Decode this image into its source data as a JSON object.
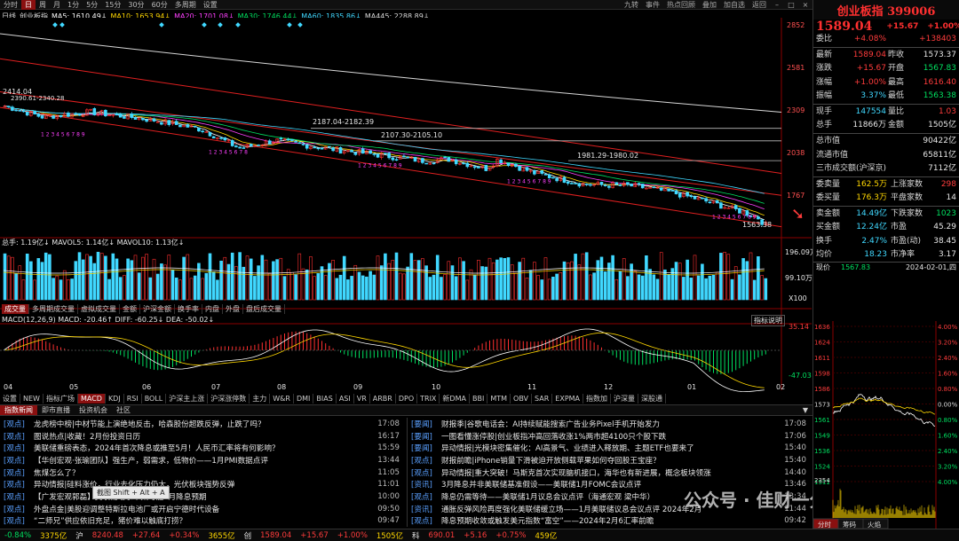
{
  "toolbar": {
    "periods": [
      "分时",
      "日",
      "周",
      "月",
      "1分",
      "5分",
      "15分",
      "30分",
      "60分",
      "多周期",
      "设置"
    ],
    "active": "日",
    "right": [
      "九转",
      "事件",
      "热点回顾",
      "叠加",
      "加自选",
      "返回"
    ]
  },
  "ma": {
    "label": "日线",
    "name": "创业板指",
    "items": [
      {
        "t": "MA5: 1610.49↓",
        "c": "#ffffff"
      },
      {
        "t": "MA10: 1653.94↓",
        "c": "#ffd700"
      },
      {
        "t": "MA20: 1701.08↓",
        "c": "#ff40ff"
      },
      {
        "t": "MA30: 1746.44↓",
        "c": "#00e060"
      },
      {
        "t": "MA60: 1835.86↓",
        "c": "#40d8ff"
      },
      {
        "t": "MA445: 2288.89↓",
        "c": "#d8d8d8"
      }
    ]
  },
  "price_axis": [
    "2852",
    "2581",
    "2309",
    "2038",
    "1767"
  ],
  "annotations": {
    "a1": "2414.04",
    "a2": "2390.61-2340.28",
    "a3": "2187.04-2182.39",
    "a4": "2107.30-2105.10",
    "a5": "1981.29-1980.02",
    "low": "1563.38"
  },
  "vol": {
    "head": "总手: 1.19亿↓  MAVOL5: 1.14亿↓  MAVOL10: 1.13亿↓",
    "axis": [
      "196.09万",
      "99.10万",
      "X100"
    ],
    "tabs": [
      "成交量",
      "多周期成交量",
      "虚拟成交量",
      "金额",
      "沪深金额",
      "换手率",
      "内盘",
      "外盘",
      "盘后成交量"
    ]
  },
  "macd": {
    "head": "MACD(12,26,9)  MACD: -20.46↑  DIFF: -60.25↓  DEA: -50.02↓",
    "btn": "指标说明",
    "axis": [
      "35.14",
      "-47.03"
    ],
    "months": [
      "04",
      "05",
      "06",
      "07",
      "08",
      "09",
      "10",
      "11",
      "12",
      "01",
      "02"
    ]
  },
  "ind_tabs": [
    "设置",
    "NEW",
    "指标广场",
    "MACD",
    "KDJ",
    "RSI",
    "BOLL",
    "沪深主上涨",
    "沪深涨停数",
    "主力",
    "W&R",
    "DMI",
    "BIAS",
    "ASI",
    "VR",
    "ARBR",
    "DPO",
    "TRIX",
    "新DMA",
    "BBI",
    "MTM",
    "OBV",
    "SAR",
    "EXPMA",
    "指数加",
    "沪深量",
    "深股通"
  ],
  "quote": {
    "title": "创业板指 399006",
    "price": "1589.04",
    "chg": "+15.67",
    "pct": "+1.00%",
    "rows": [
      [
        "委比",
        "+4.08%",
        "",
        "+138403"
      ],
      [
        "最新",
        "1589.04",
        "昨收",
        "1573.37"
      ],
      [
        "涨跌",
        "+15.67",
        "开盘",
        "1567.83"
      ],
      [
        "涨幅",
        "+1.00%",
        "最高",
        "1616.40"
      ],
      [
        "振幅",
        "3.37%",
        "最低",
        "1563.38"
      ],
      [
        "现手",
        "147554",
        "量比",
        "1.03"
      ],
      [
        "总手",
        "11866万",
        "金额",
        "1505亿"
      ]
    ],
    "rows2": [
      [
        "总市值",
        "",
        "90422亿"
      ],
      [
        "流通市值",
        "",
        "65811亿"
      ],
      [
        "三市成交额(沪深京)",
        "",
        "7112亿"
      ]
    ],
    "rows3": [
      [
        "委卖量",
        "162.5万",
        "上涨家数",
        "298"
      ],
      [
        "委买量",
        "176.3万",
        "平盘家数",
        "14"
      ],
      [
        "卖金额",
        "14.49亿",
        "下跌家数",
        "1023"
      ],
      [
        "买金额",
        "12.24亿",
        "市盈",
        "45.29"
      ],
      [
        "换手",
        "2.47%",
        "市盈(动)",
        "38.45"
      ],
      [
        "均价",
        "18.23",
        "市净率",
        "3.17"
      ]
    ],
    "mini_head": [
      "现价",
      "1567.83",
      "2024-02-01,四"
    ],
    "mini_left": [
      "1636",
      "1624",
      "1611",
      "1598",
      "1586",
      "1573",
      "1561",
      "1549",
      "1536",
      "1524",
      "1511"
    ],
    "mini_right": [
      "4.00%",
      "3.20%",
      "2.40%",
      "1.60%",
      "0.80%",
      "0.00%",
      "0.80%",
      "1.60%",
      "2.40%",
      "3.20%",
      "4.00%"
    ],
    "mini_vol": "2354",
    "mini_tabs": [
      "分时",
      "筹码",
      "火焰"
    ]
  },
  "news": {
    "tabs": [
      "指数新闻",
      "即市直播",
      "投资机会",
      "社区"
    ],
    "left": [
      [
        "观点",
        "龙虎榜中榜|中材节能上演绝地反击，哈森股份超跌反弹，止跌了吗？",
        "17:08"
      ],
      [
        "观点",
        "图说热点|收藏！2月份投资日历",
        "16:17"
      ],
      [
        "观点",
        "美联储重磅表态，2024年首次降息或推至5月！人民币汇率将有何影响？",
        "15:59"
      ],
      [
        "观点",
        "【华创宏观·张瑜团队】强生产，弱需求，低物价——1月PMI数据点评",
        "13:44"
      ],
      [
        "观点",
        "焦煤怎么了？",
        "11:05"
      ],
      [
        "观点",
        "异动情报|硅料涨价，行业去化压力仍大，光伏板块强势反弹",
        "11:01"
      ],
      [
        "观点",
        "【广发宏观郭磊】美联储暗示不太可能3月降息预期",
        "10:00"
      ],
      [
        "观点",
        "外盘点金|美股迎调整特斯拉电池厂或开启宁德时代设备",
        "09:50"
      ],
      [
        "观点",
        "“二师兄”供应依旧充足，猪价难以触底打捞？",
        "09:47"
      ]
    ],
    "right": [
      [
        "要闻",
        "财报季|谷歌电话会：AI持续赋能搜索广告业务Pixel手机开始发力",
        "17:08"
      ],
      [
        "要闻",
        "一图看懂涨停股|创业板指冲高回落收涨1%两市超4100只个股下跌",
        "17:06"
      ],
      [
        "要闻",
        "异动情报|光模块密集催化：AI高景气、业绩进入释放期、主题ETF也要来了",
        "15:40"
      ],
      [
        "观点",
        "财报前瞻|iPhone销量下滑被迫开放侧载苹果如何夺回股王宝座？",
        "15:40"
      ],
      [
        "观点",
        "异动情报|重大突破！马斯克首次实现脑机接口，海华也有新进展，概念板块领涨",
        "14:40"
      ],
      [
        "资讯",
        "3月降息并非美联储基准假设——美联储1月FOMC会议点评",
        "13:46"
      ],
      [
        "观点",
        "降息仍需等待——美联储1月议息会议点评（海通宏观 梁中华）",
        "13:34"
      ],
      [
        "资讯",
        "通胀反弹风险再度强化美联储缓立场——1月美联储议息会议点评 2024年2月",
        "11:44"
      ],
      [
        "观点",
        "降息预期收敛或触发美元指数“富空”——2024年2月6汇率前瞻",
        "09:42"
      ]
    ]
  },
  "status": [
    "-0.84%",
    "3375亿",
    "沪",
    "8240.48",
    "+27.64",
    "+0.34%",
    "3655亿",
    "创",
    "1589.04",
    "+15.67",
    "+1.00%",
    "1505亿",
    "科",
    "690.01",
    "+5.16",
    "+0.75%",
    "459亿"
  ],
  "tip": "截图 Shift + Alt + A",
  "watermark": "公众号 · 佳财一分钟",
  "chart_data": {
    "type": "candlestick",
    "title": "创业板指 日线",
    "price_axis": [
      2852,
      2581,
      2309,
      2038,
      1767
    ],
    "last": 1589.04,
    "low": 1563.38,
    "high": 2414.04,
    "ma": {
      "MA5": 1610.49,
      "MA10": 1653.94,
      "MA20": 1701.08,
      "MA30": 1746.44,
      "MA60": 1835.86,
      "MA445": 2288.89
    },
    "macd": {
      "MACD": -20.46,
      "DIFF": -60.25,
      "DEA": -50.02
    },
    "x_months": [
      "04",
      "05",
      "06",
      "07",
      "08",
      "09",
      "10",
      "11",
      "12",
      "01",
      "02"
    ]
  }
}
